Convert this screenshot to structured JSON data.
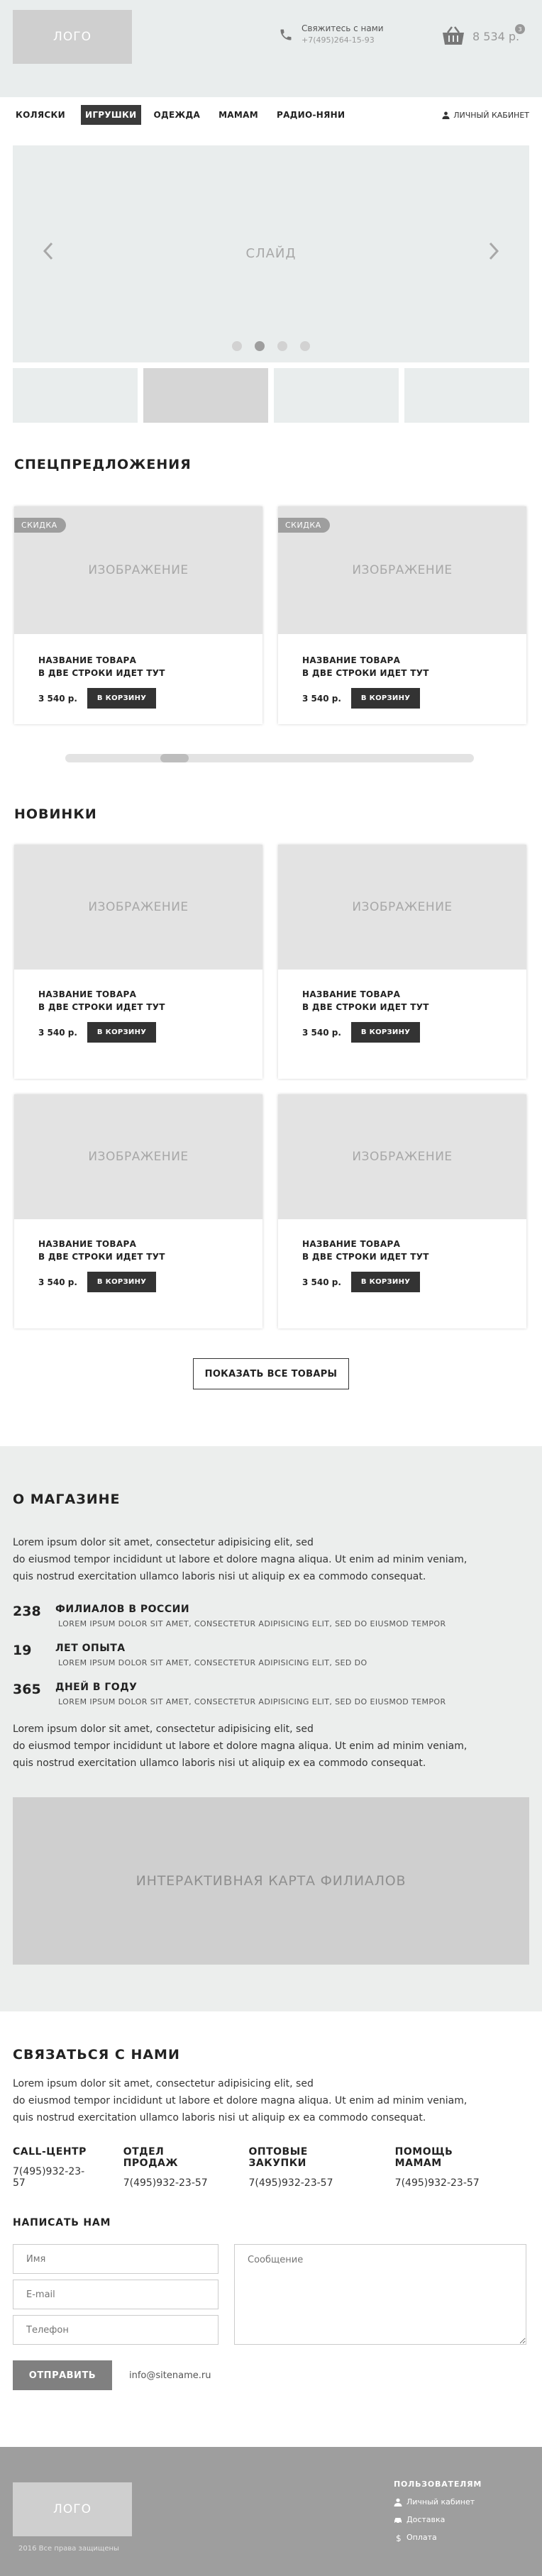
{
  "header": {
    "logo": "ЛОГО",
    "contact_label": "Свяжитесь с нами",
    "contact_phone": "+7(495)264-15-93",
    "cart_sum": "8 534 р.",
    "cart_count": "3"
  },
  "nav": {
    "items": [
      "КОЛЯСКИ",
      "ИГРУШКИ",
      "ОДЕЖДА",
      "МАМАМ",
      "РАДИО-НЯНИ"
    ],
    "active": "ИГРУШКИ",
    "account": "ЛИЧНЫЙ КАБИНЕТ"
  },
  "slider": {
    "label": "СЛАЙД",
    "dot_count": 4,
    "active_dot": 2
  },
  "specials": {
    "title": "СПЕЦПРЕДЛОЖЕНИЯ",
    "cards": [
      {
        "badge": "СКИДКА",
        "image": "ИЗОБРАЖЕНИЕ",
        "title_line1": "НАЗВАНИЕ ТОВАРА",
        "title_line2": "В ДВЕ СТРОКИ ИДЕТ ТУТ",
        "price": "3 540 р.",
        "button": "В КОРЗИНУ"
      },
      {
        "badge": "СКИДКА",
        "image": "ИЗОБРАЖЕНИЕ",
        "title_line1": "НАЗВАНИЕ ТОВАРА",
        "title_line2": "В ДВЕ СТРОКИ ИДЕТ ТУТ",
        "price": "3 540 р.",
        "button": "В КОРЗИНУ"
      }
    ]
  },
  "news": {
    "title": "НОВИНКИ",
    "cards": [
      {
        "image": "ИЗОБРАЖЕНИЕ",
        "title_line1": "НАЗВАНИЕ ТОВАРА",
        "title_line2": "В ДВЕ СТРОКИ ИДЕТ ТУТ",
        "price": "3 540 р.",
        "button": "В КОРЗИНУ"
      },
      {
        "image": "ИЗОБРАЖЕНИЕ",
        "title_line1": "НАЗВАНИЕ ТОВАРА",
        "title_line2": "В ДВЕ СТРОКИ ИДЕТ ТУТ",
        "price": "3 540 р.",
        "button": "В КОРЗИНУ"
      },
      {
        "image": "ИЗОБРАЖЕНИЕ",
        "title_line1": "НАЗВАНИЕ ТОВАРА",
        "title_line2": "В ДВЕ СТРОКИ ИДЕТ ТУТ",
        "price": "3 540 р.",
        "button": "В КОРЗИНУ"
      },
      {
        "image": "ИЗОБРАЖЕНИЕ",
        "title_line1": "НАЗВАНИЕ ТОВАРА",
        "title_line2": "В ДВЕ СТРОКИ ИДЕТ ТУТ",
        "price": "3 540 р.",
        "button": "В КОРЗИНУ"
      }
    ],
    "show_all": "ПОКАЗАТЬ ВСЕ ТОВАРЫ"
  },
  "about": {
    "title": "О МАГАЗИНЕ",
    "text1_line1": "Lorem ipsum dolor sit amet, consectetur adipisicing elit, sed",
    "text1_line2": "do eiusmod tempor incididunt ut labore et dolore magna aliqua. Ut enim ad minim veniam,",
    "text1_line3": "quis nostrud exercitation ullamco laboris nisi ut aliquip ex ea commodo consequat.",
    "stats": [
      {
        "num": "238",
        "title": "ФИЛИАЛОВ В РОССИИ",
        "desc": "LOREM IPSUM DOLOR SIT AMET, CONSECTETUR ADIPISICING ELIT, SED DO EIUSMOD TEMPOR"
      },
      {
        "num": "19",
        "title": "ЛЕТ ОПЫТА",
        "desc": "LOREM IPSUM DOLOR SIT AMET, CONSECTETUR ADIPISICING ELIT, SED DO"
      },
      {
        "num": "365",
        "title": "ДНЕЙ В ГОДУ",
        "desc": "LOREM IPSUM DOLOR SIT AMET, CONSECTETUR ADIPISICING ELIT, SED DO EIUSMOD TEMPOR"
      }
    ],
    "text2_line1": "Lorem ipsum dolor sit amet, consectetur adipisicing elit, sed",
    "text2_line2": "do eiusmod tempor incididunt ut labore et dolore magna aliqua. Ut enim ad minim veniam,",
    "text2_line3": "quis nostrud exercitation ullamco laboris nisi ut aliquip ex ea commodo consequat.",
    "map": "ИНТЕРАКТИВНАЯ КАРТА ФИЛИАЛОВ"
  },
  "contacts": {
    "title": "СВЯЗАТЬСЯ С НАМИ",
    "text_line1": "Lorem ipsum dolor sit amet, consectetur adipisicing elit, sed",
    "text_line2": "do eiusmod tempor incididunt ut labore et dolore magna aliqua. Ut enim ad minim veniam,",
    "text_line3": "quis nostrud exercitation ullamco laboris nisi ut aliquip ex ea commodo consequat.",
    "departments": [
      {
        "title": "CALL-ЦЕНТР",
        "phone": "7(495)932-23-57"
      },
      {
        "title": "ОТДЕЛ ПРОДАЖ",
        "phone": "7(495)932-23-57"
      },
      {
        "title": "ОПТОВЫЕ ЗАКУПКИ",
        "phone": "7(495)932-23-57"
      },
      {
        "title": "ПОМОЩЬ МАМАМ",
        "phone": "7(495)932-23-57"
      }
    ],
    "write_title": "НАПИСАТЬ НАМ",
    "name_placeholder": "Имя",
    "email_placeholder": "E-mail",
    "phone_placeholder": "Телефон",
    "message_placeholder": "Сообщение",
    "submit": "ОТПРАВИТЬ",
    "email": "info@sitename.ru"
  },
  "footer": {
    "logo": "ЛОГО",
    "copyright": "2016 Все права защищены",
    "menu_title": "ПОЛЬЗОВАТЕЛЯМ",
    "links": [
      "Личный кабинет",
      "Доставка",
      "Оплата"
    ]
  }
}
